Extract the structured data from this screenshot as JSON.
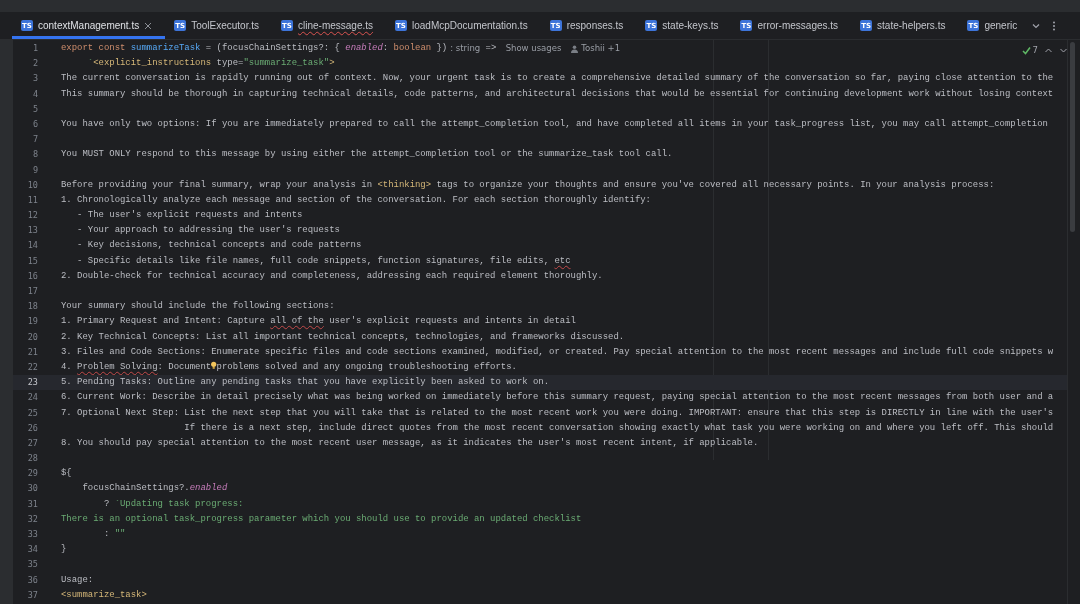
{
  "tabs": [
    {
      "badge": "TS",
      "label": "contextManagement.ts",
      "selected": true,
      "closable": true,
      "error": false
    },
    {
      "badge": "TS",
      "label": "ToolExecutor.ts",
      "selected": false,
      "closable": false,
      "error": false
    },
    {
      "badge": "TS",
      "label": "cline-message.ts",
      "selected": false,
      "closable": false,
      "error": true
    },
    {
      "badge": "TS",
      "label": "loadMcpDocumentation.ts",
      "selected": false,
      "closable": false,
      "error": false
    },
    {
      "badge": "TS",
      "label": "responses.ts",
      "selected": false,
      "closable": false,
      "error": false
    },
    {
      "badge": "TS",
      "label": "state-keys.ts",
      "selected": false,
      "closable": false,
      "error": false
    },
    {
      "badge": "TS",
      "label": "error-messages.ts",
      "selected": false,
      "closable": false,
      "error": false
    },
    {
      "badge": "TS",
      "label": "state-helpers.ts",
      "selected": false,
      "closable": false,
      "error": false
    },
    {
      "badge": "TS",
      "label": "generic",
      "selected": false,
      "closable": false,
      "error": false
    }
  ],
  "inspections": {
    "count": "7"
  },
  "lines": [
    {
      "n": "1",
      "current": false,
      "segments": [
        {
          "kind": "keyword",
          "text": "export const "
        },
        {
          "kind": "function",
          "text": "summarizeTask"
        },
        {
          "kind": "plain",
          "text": " = (focusChainSettings?: { "
        },
        {
          "kind": "property",
          "text": "enabled"
        },
        {
          "kind": "plain",
          "text": ": "
        },
        {
          "kind": "keyword",
          "text": "boolean"
        },
        {
          "kind": "plain",
          "text": " })"
        },
        {
          "kind": "hint",
          "text": ": string"
        },
        {
          "kind": "plain",
          "text": " => "
        },
        {
          "kind": "usages",
          "text": "Show usages"
        },
        {
          "kind": "author",
          "text": "Toshii +1"
        }
      ]
    },
    {
      "n": "2",
      "current": false,
      "segments": [
        {
          "kind": "string",
          "text": "     `"
        },
        {
          "kind": "tag",
          "text": "<explicit_instructions"
        },
        {
          "kind": "plain",
          "text": " type="
        },
        {
          "kind": "string",
          "text": "\"summarize_task\""
        },
        {
          "kind": "tag",
          "text": ">"
        }
      ]
    },
    {
      "n": "3",
      "current": false,
      "segments": [
        {
          "kind": "plain",
          "text": "The current conversation is rapidly running out of context. Now, your urgent task is to create a comprehensive detailed summary of the conversation so far, paying close attention to the"
        }
      ]
    },
    {
      "n": "4",
      "current": false,
      "segments": [
        {
          "kind": "plain",
          "text": "This summary should be thorough in capturing technical details, code patterns, and architectural decisions that would be essential for continuing development work without losing context"
        }
      ]
    },
    {
      "n": "5",
      "current": false
    },
    {
      "n": "6",
      "current": false,
      "segments": [
        {
          "kind": "plain",
          "text": "You have only two options: If you are immediately prepared to call the attempt_completion tool, and have completed all items in your task_progress list, you may call attempt_completion"
        }
      ]
    },
    {
      "n": "7",
      "current": false
    },
    {
      "n": "8",
      "current": false,
      "segments": [
        {
          "kind": "plain",
          "text": "You MUST ONLY respond to this message by using either the attempt_completion tool or the summarize_task tool call."
        }
      ]
    },
    {
      "n": "9",
      "current": false
    },
    {
      "n": "10",
      "current": false,
      "segments": [
        {
          "kind": "plain",
          "text": "Before providing your final summary, wrap your analysis in "
        },
        {
          "kind": "tag",
          "text": "<thinking>"
        },
        {
          "kind": "plain",
          "text": " tags to organize your thoughts and ensure you've covered all necessary points. In your analysis process:"
        }
      ]
    },
    {
      "n": "11",
      "current": false,
      "segments": [
        {
          "kind": "plain",
          "text": "1. Chronologically analyze each message and section of the conversation. For each section thoroughly identify:"
        }
      ]
    },
    {
      "n": "12",
      "current": false,
      "segments": [
        {
          "kind": "plain",
          "text": "   - The user's explicit requests and intents"
        }
      ]
    },
    {
      "n": "13",
      "current": false,
      "segments": [
        {
          "kind": "plain",
          "text": "   - Your approach to addressing the user's requests"
        }
      ]
    },
    {
      "n": "14",
      "current": false,
      "segments": [
        {
          "kind": "plain",
          "text": "   - Key decisions, technical concepts and code patterns"
        }
      ]
    },
    {
      "n": "15",
      "current": false,
      "segments": [
        {
          "kind": "plain",
          "text": "   - Specific details like file names, full code snippets, function signatures, file edits, "
        },
        {
          "kind": "typo",
          "text": "etc"
        }
      ]
    },
    {
      "n": "16",
      "current": false,
      "segments": [
        {
          "kind": "plain",
          "text": "2. Double-check for technical accuracy and completeness, addressing each required element thoroughly."
        }
      ]
    },
    {
      "n": "17",
      "current": false
    },
    {
      "n": "18",
      "current": false,
      "segments": [
        {
          "kind": "plain",
          "text": "Your summary should include the following sections:"
        }
      ]
    },
    {
      "n": "19",
      "current": false,
      "segments": [
        {
          "kind": "plain",
          "text": "1. Primary Request and Intent: Capture "
        },
        {
          "kind": "typo",
          "text": "all of the"
        },
        {
          "kind": "plain",
          "text": " user's explicit requests and intents in detail"
        }
      ]
    },
    {
      "n": "20",
      "current": false,
      "segments": [
        {
          "kind": "plain",
          "text": "2. Key Technical Concepts: List all important technical concepts, technologies, and frameworks discussed."
        }
      ]
    },
    {
      "n": "21",
      "current": false,
      "segments": [
        {
          "kind": "plain",
          "text": "3. Files and Code Sections: Enumerate specific files and code sections examined, modified, or created. Pay special attention to the most recent messages and include full code snippets w"
        }
      ]
    },
    {
      "n": "22",
      "current": false,
      "segments": [
        {
          "kind": "plain",
          "text": "4. "
        },
        {
          "kind": "typo",
          "text": "Problem Solving"
        },
        {
          "kind": "plain",
          "text": ": Document"
        },
        {
          "kind": "bulb"
        },
        {
          "kind": "plain",
          "text": "problems solved and any ongoing troubleshooting efforts."
        }
      ]
    },
    {
      "n": "23",
      "current": true,
      "segments": [
        {
          "kind": "plain",
          "text": "5. Pending Tasks: Outline any pending tasks that you have explicitly been asked to work on."
        }
      ]
    },
    {
      "n": "24",
      "current": false,
      "segments": [
        {
          "kind": "plain",
          "text": "6. Current Work: Describe in detail precisely what was being worked on immediately before this summary request, paying special attention to the most recent messages from both user and a"
        }
      ]
    },
    {
      "n": "25",
      "current": false,
      "segments": [
        {
          "kind": "plain",
          "text": "7. Optional Next Step: List the next step that you will take that is related to the most recent work you were doing. IMPORTANT: ensure that this step is DIRECTLY in line with the user's"
        }
      ]
    },
    {
      "n": "26",
      "current": false,
      "segments": [
        {
          "kind": "plain",
          "text": "                       If there is a next step, include direct quotes from the most recent conversation showing exactly what task you were working on and where you left off. This should"
        }
      ]
    },
    {
      "n": "27",
      "current": false,
      "segments": [
        {
          "kind": "plain",
          "text": "8. You should pay special attention to the most recent user message, as it indicates the user's most recent intent, if applicable."
        }
      ]
    },
    {
      "n": "28",
      "current": false
    },
    {
      "n": "29",
      "current": false,
      "segments": [
        {
          "kind": "plain",
          "text": "${"
        }
      ]
    },
    {
      "n": "30",
      "current": false,
      "segments": [
        {
          "kind": "plain",
          "text": "    focusChainSettings?."
        },
        {
          "kind": "property",
          "text": "enabled"
        }
      ]
    },
    {
      "n": "31",
      "current": false,
      "segments": [
        {
          "kind": "plain",
          "text": "        ? "
        },
        {
          "kind": "string",
          "text": "`Updating task progress:"
        }
      ]
    },
    {
      "n": "32",
      "current": false,
      "segments": [
        {
          "kind": "string",
          "text": "There is an optional task_progress parameter which you should use to provide an updated checklist"
        }
      ]
    },
    {
      "n": "33",
      "current": false,
      "segments": [
        {
          "kind": "plain",
          "text": "        : "
        },
        {
          "kind": "string",
          "text": "\"\""
        }
      ]
    },
    {
      "n": "34",
      "current": false,
      "segments": [
        {
          "kind": "plain",
          "text": "}"
        }
      ]
    },
    {
      "n": "35",
      "current": false
    },
    {
      "n": "36",
      "current": false,
      "segments": [
        {
          "kind": "plain",
          "text": "Usage:"
        }
      ]
    },
    {
      "n": "37",
      "current": false,
      "segments": [
        {
          "kind": "tag",
          "text": "<summarize_task>"
        }
      ]
    }
  ]
}
